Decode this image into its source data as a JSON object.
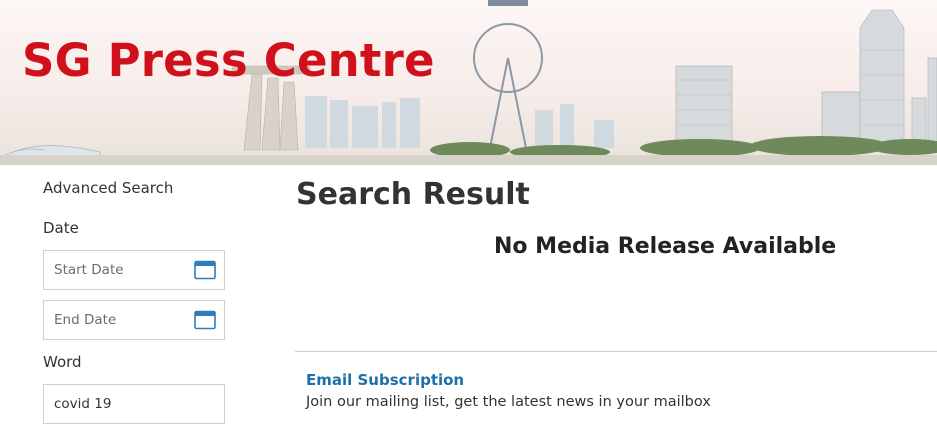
{
  "header": {
    "site_title": "SG Press Centre",
    "title_color": "#d0111b",
    "banner_image": "singapore-skyline"
  },
  "sidebar": {
    "advanced_search_label": "Advanced Search",
    "date_label": "Date",
    "start_date": {
      "value": "",
      "placeholder": "Start Date",
      "icon": "calendar-icon"
    },
    "end_date": {
      "value": "",
      "placeholder": "End Date",
      "icon": "calendar-icon"
    },
    "word_label": "Word",
    "word_input": {
      "value": "covid 19",
      "placeholder": ""
    }
  },
  "main": {
    "heading": "Search Result",
    "empty_message": "No Media Release Available",
    "subscription": {
      "title": "Email Subscription",
      "description": "Join our mailing list, get the latest news in your mailbox",
      "link_color": "#1f6fa8"
    }
  }
}
